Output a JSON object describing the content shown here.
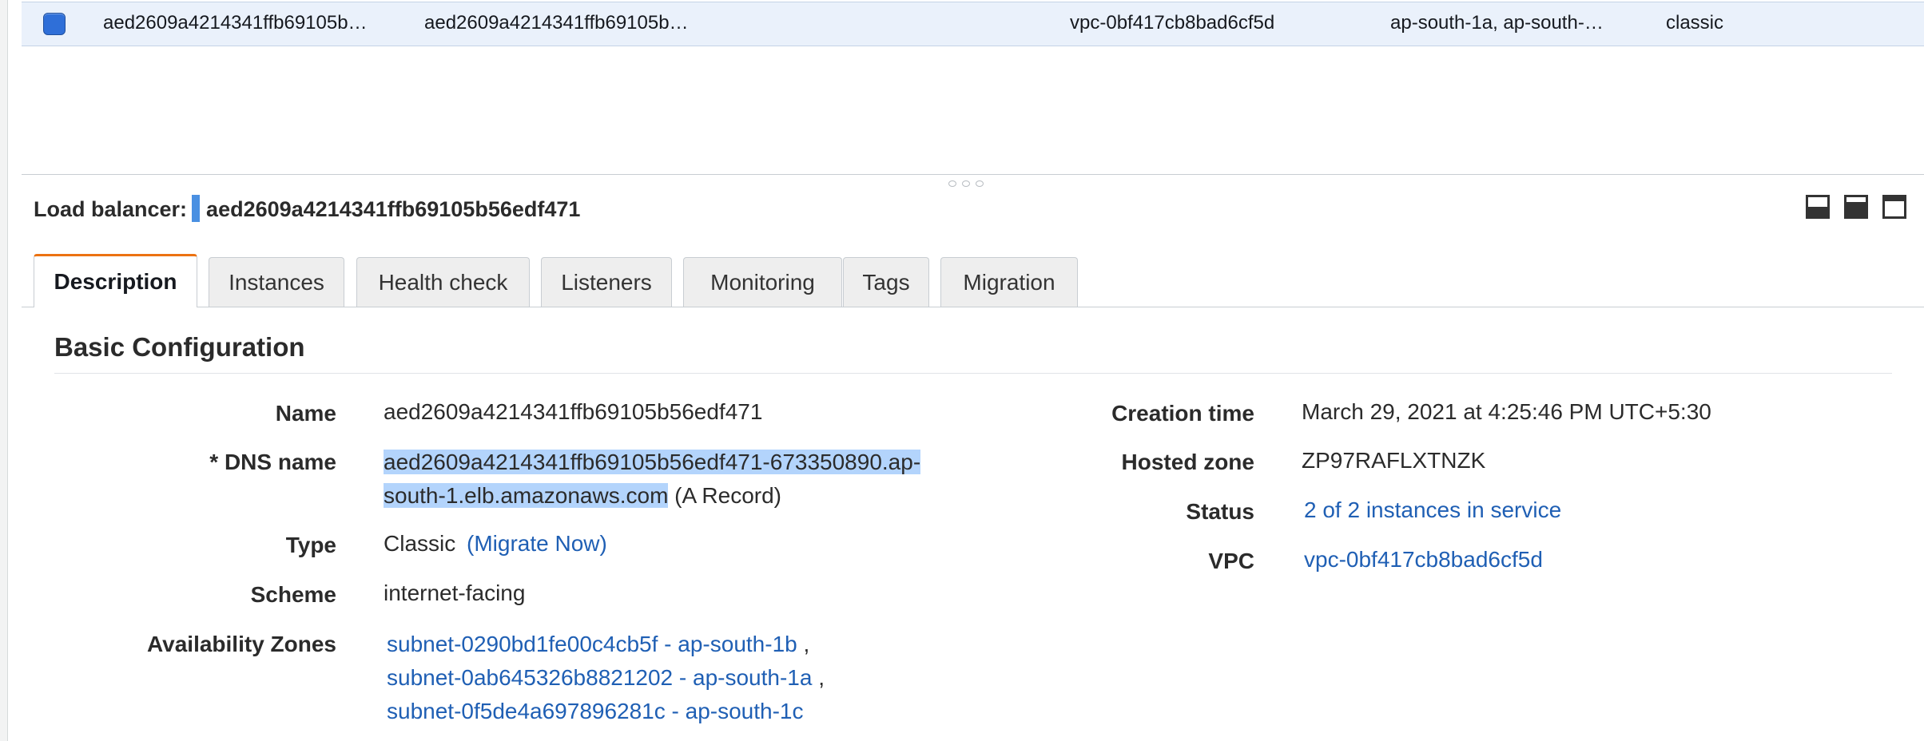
{
  "table_row": {
    "name": "aed2609a4214341ffb69105b…",
    "dns_name": "aed2609a4214341ffb69105b…",
    "vpc_id": "vpc-0bf417cb8bad6cf5d",
    "availability_zones": "ap-south-1a, ap-south-…",
    "type": "classic"
  },
  "load_balancer": {
    "label": "Load balancer:",
    "name": "aed2609a4214341ffb69105b56edf471"
  },
  "tabs": [
    {
      "label": "Description",
      "active": true
    },
    {
      "label": "Instances"
    },
    {
      "label": "Health check"
    },
    {
      "label": "Listeners"
    },
    {
      "label": "Monitoring"
    },
    {
      "label": "Tags"
    },
    {
      "label": "Migration"
    }
  ],
  "basic_configuration": {
    "title": "Basic Configuration",
    "name": {
      "label": "Name",
      "value": "aed2609a4214341ffb69105b56edf471"
    },
    "dns_name": {
      "label": "* DNS name",
      "value_line1": "aed2609a4214341ffb69105b56edf471-673350890.ap-",
      "value_line2": "south-1.elb.amazonaws.com",
      "suffix": " (A Record)"
    },
    "type": {
      "label": "Type",
      "value": "Classic",
      "link": "(Migrate Now)"
    },
    "scheme": {
      "label": "Scheme",
      "value": "internet-facing"
    },
    "availability_zones": {
      "label": "Availability Zones",
      "items": [
        "subnet-0290bd1fe00c4cb5f - ap-south-1b",
        "subnet-0ab645326b8821202 - ap-south-1a",
        "subnet-0f5de4a697896281c - ap-south-1c"
      ]
    },
    "creation_time": {
      "label": "Creation time",
      "value": "March 29, 2021 at 4:25:46 PM UTC+5:30"
    },
    "hosted_zone": {
      "label": "Hosted zone",
      "value": "ZP97RAFLXTNZK"
    },
    "status": {
      "label": "Status",
      "value": "2 of 2 instances in service"
    },
    "vpc": {
      "label": "VPC",
      "value": "vpc-0bf417cb8bad6cf5d"
    }
  },
  "colors": {
    "accent_tab": "#ec7211",
    "link": "#1f5fb4",
    "selection": "#b3d4fc",
    "row_selected": "#eaf1fb"
  },
  "icons": {
    "row_checkbox": "checkbox-checked-icon",
    "layout_buttons": [
      "panel-bottom-icon",
      "panel-split-icon",
      "panel-top-icon"
    ]
  }
}
